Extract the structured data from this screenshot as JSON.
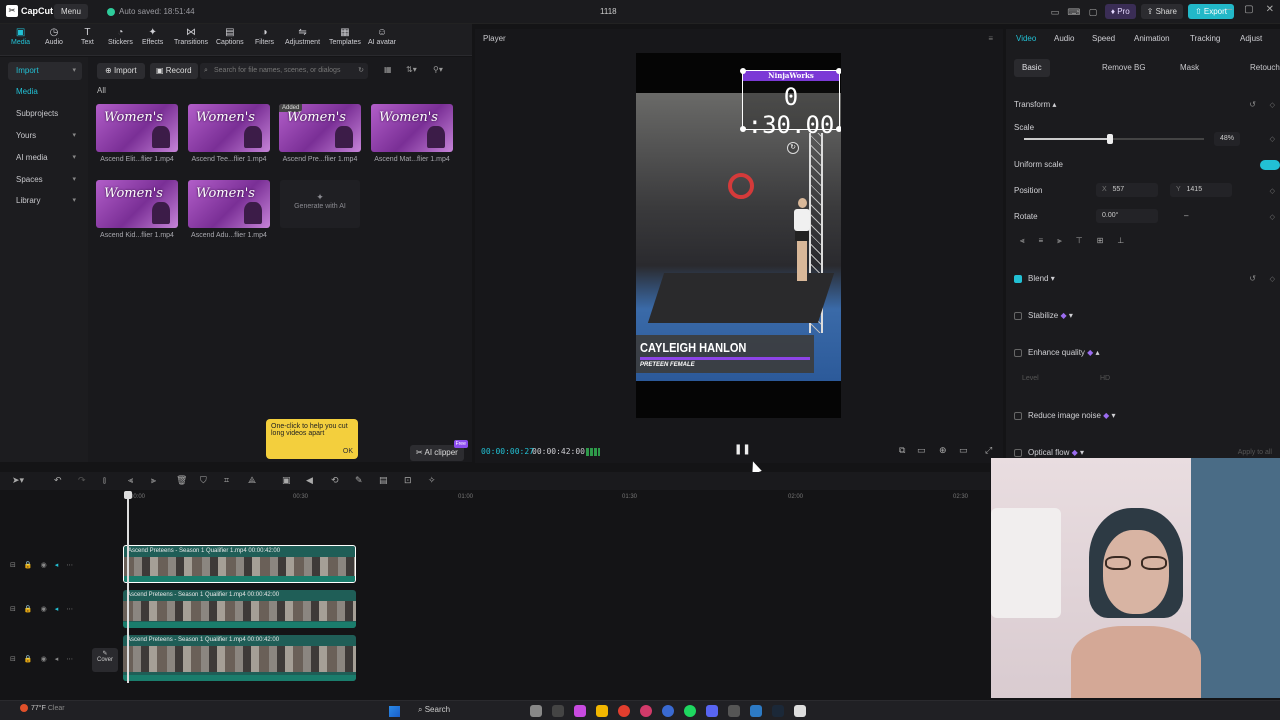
{
  "app": {
    "name": "CapCut",
    "menu_label": "Menu",
    "autosave": "Auto saved: 18:51:44",
    "project_title": "1118",
    "pro_label": "Pro",
    "share_label": "Share",
    "export_label": "Export"
  },
  "toolbar": {
    "items": [
      {
        "label": "Media",
        "icon": "media-icon"
      },
      {
        "label": "Audio",
        "icon": "audio-icon"
      },
      {
        "label": "Text",
        "icon": "text-icon"
      },
      {
        "label": "Stickers",
        "icon": "stickers-icon"
      },
      {
        "label": "Effects",
        "icon": "effects-icon"
      },
      {
        "label": "Transitions",
        "icon": "transitions-icon"
      },
      {
        "label": "Captions",
        "icon": "captions-icon"
      },
      {
        "label": "Filters",
        "icon": "filters-icon"
      },
      {
        "label": "Adjustment",
        "icon": "adjustment-icon"
      },
      {
        "label": "Templates",
        "icon": "templates-icon"
      },
      {
        "label": "AI avatar",
        "icon": "ai-avatar-icon"
      }
    ]
  },
  "sidebar": {
    "items": [
      {
        "label": "Import"
      },
      {
        "label": "Media"
      },
      {
        "label": "Subprojects"
      },
      {
        "label": "Yours"
      },
      {
        "label": "AI media"
      },
      {
        "label": "Spaces"
      },
      {
        "label": "Library"
      }
    ]
  },
  "media": {
    "import_label": "Import",
    "record_label": "Record",
    "search_placeholder": "Search for file names, scenes, or dialogs",
    "all_label": "All",
    "thumb_text": "Women's",
    "added_badge": "Added",
    "items": [
      {
        "caption": "Ascend Elit...flier 1.mp4"
      },
      {
        "caption": "Ascend Tee...flier 1.mp4"
      },
      {
        "caption": "Ascend Pre...flier 1.mp4"
      },
      {
        "caption": "Ascend Mat...flier 1.mp4"
      },
      {
        "caption": "Ascend Kid...flier 1.mp4"
      },
      {
        "caption": "Ascend Adu...flier 1.mp4"
      }
    ],
    "generate_ai": "Generate with AI",
    "tip_text": "One-click to help you cut long videos apart",
    "tip_ok": "OK",
    "ai_clipper": "AI clipper",
    "free_badge": "Free"
  },
  "player": {
    "label": "Player",
    "timer_header": "NinjaWorks",
    "timer_value": "0 :30.00",
    "name_plate": "CAYLEIGH HANLON",
    "name_sub": "PRETEEN FEMALE",
    "time_current": "00:00:00:27",
    "time_total": "00:00:42:00"
  },
  "properties": {
    "tabs": [
      "Video",
      "Audio",
      "Speed",
      "Animation",
      "Tracking",
      "Adjust"
    ],
    "subtabs": [
      "Basic",
      "Remove BG",
      "Mask",
      "Retouch"
    ],
    "transform_label": "Transform",
    "scale_label": "Scale",
    "scale_value": "48%",
    "scale_fraction": 0.48,
    "uniform_scale_label": "Uniform scale",
    "position_label": "Position",
    "pos_x_label": "X",
    "pos_x": "557",
    "pos_y_label": "Y",
    "pos_y": "1415",
    "rotate_label": "Rotate",
    "rotate_value": "0.00°",
    "rotate_dash": "–",
    "blend_label": "Blend",
    "stabilize_label": "Stabilize",
    "enhance_label": "Enhance quality",
    "level_label": "Level",
    "level_value": "HD",
    "reduce_noise_label": "Reduce image noise",
    "optical_flow_label": "Optical flow",
    "apply_label": "Apply to all"
  },
  "timeline": {
    "ticks": [
      "00:00",
      "00:30",
      "01:00",
      "01:30",
      "02:00",
      "02:30"
    ],
    "clips": [
      {
        "title": "Ascend Preteens - Season 1 Qualifier 1.mp4  00:00:42:00"
      },
      {
        "title": "Ascend Preteens - Season 1 Qualifier 1.mp4  00:00:42:00"
      },
      {
        "title": "Ascend Preteens - Season 1 Qualifier 1.mp4  00:00:42:00"
      }
    ],
    "cover_label": "Cover"
  },
  "taskbar": {
    "temp": "77°F",
    "weather": "Clear",
    "search": "Search"
  },
  "colors": {
    "accent": "#22c0d4",
    "tip": "#f3cf3d",
    "purple": "#8d44e8"
  }
}
